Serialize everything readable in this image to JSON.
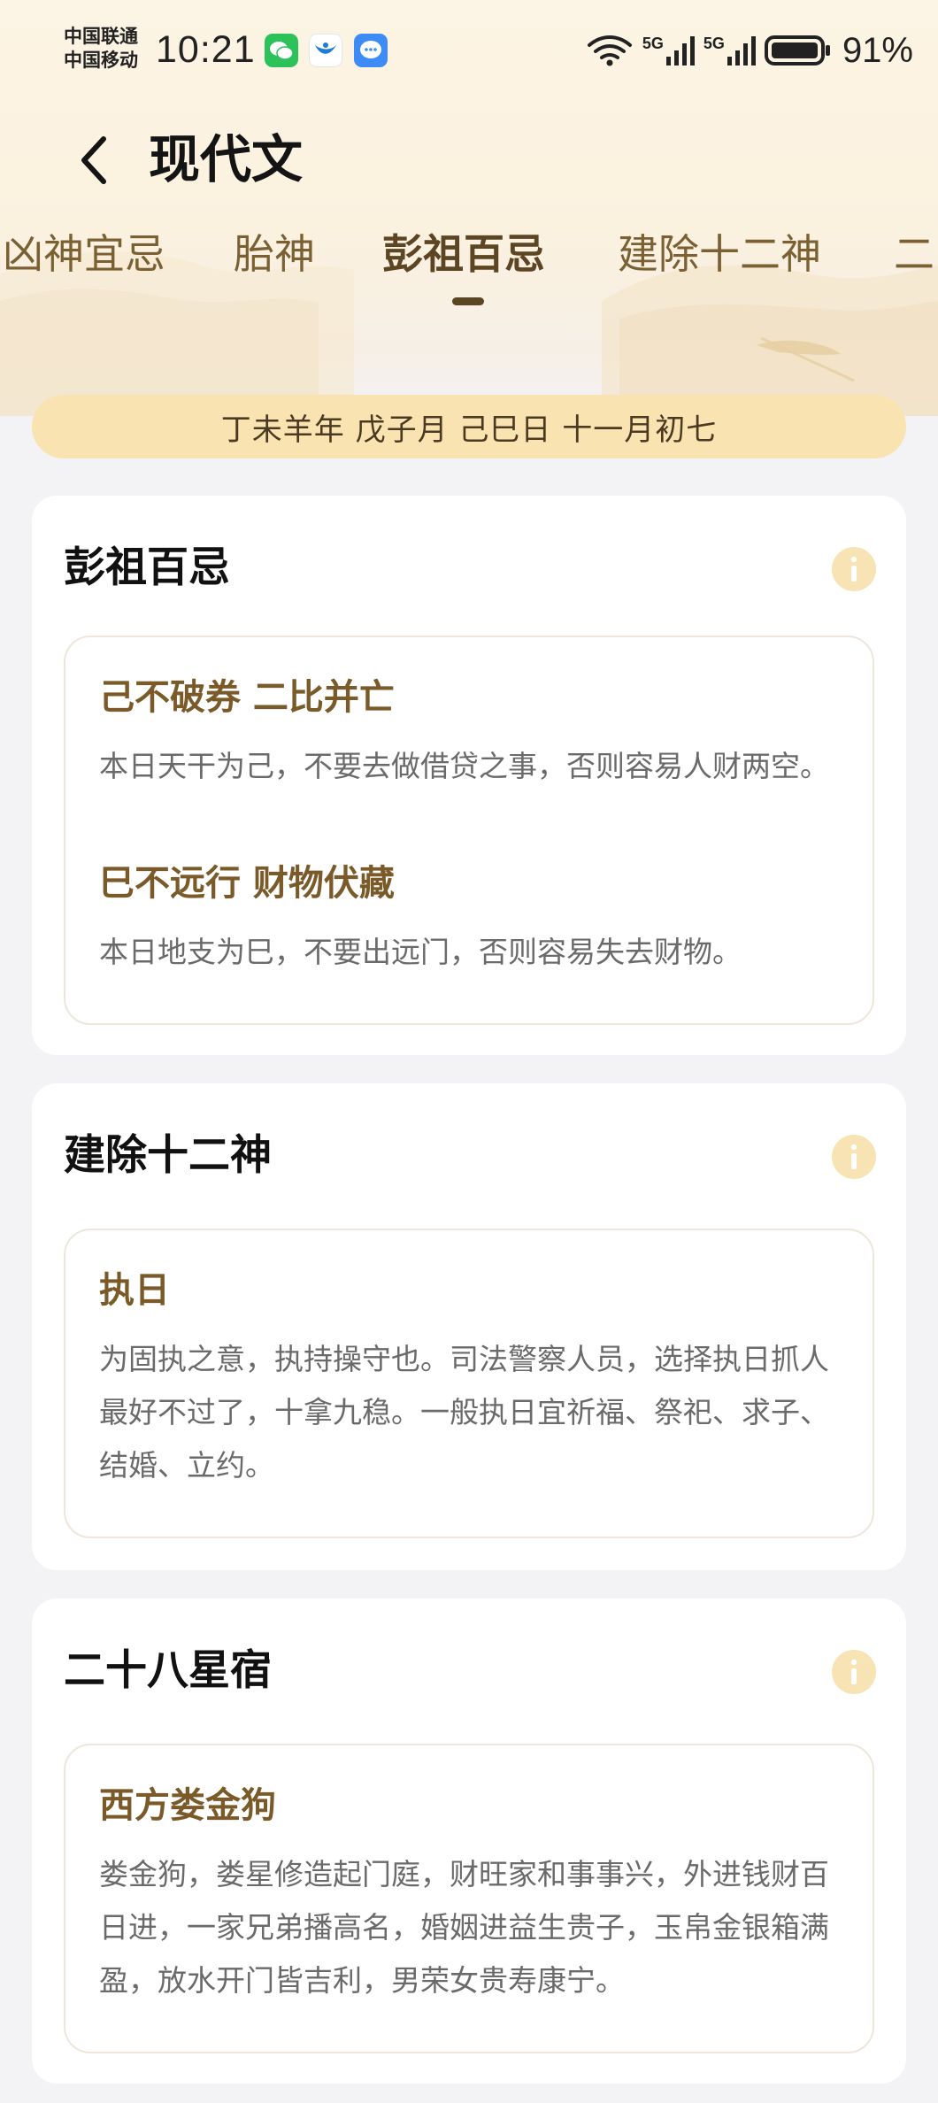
{
  "status_bar": {
    "carrier_1": "中国联通",
    "carrier_2": "中国移动",
    "time": "10:21",
    "network_1": "5G",
    "network_2": "5G",
    "battery": "91%",
    "icons": [
      "wechat-icon",
      "bird-app-icon",
      "message-icon",
      "wifi-icon",
      "signal-icon",
      "battery-icon"
    ]
  },
  "header": {
    "title": "现代文"
  },
  "tabs": [
    {
      "label": "凶神宜忌"
    },
    {
      "label": "胎神"
    },
    {
      "label": "彭祖百忌",
      "active": true
    },
    {
      "label": "建除十二神"
    },
    {
      "label": "二"
    }
  ],
  "date_banner": "丁未羊年  戊子月  己巳日  十一月初七",
  "cards": [
    {
      "title": "彭祖百忌",
      "items": [
        {
          "title": "己不破券 二比并亡",
          "desc": "本日天干为己，不要去做借贷之事，否则容易人财两空。"
        },
        {
          "title": "巳不远行 财物伏藏",
          "desc": "本日地支为巳，不要出远门，否则容易失去财物。"
        }
      ]
    },
    {
      "title": "建除十二神",
      "items": [
        {
          "title": "执日",
          "desc": "为固执之意，执持操守也。司法警察人员，选择执日抓人最好不过了，十拿九稳。一般执日宜祈福、祭祀、求子、结婚、立约。"
        }
      ]
    },
    {
      "title": "二十八星宿",
      "items": [
        {
          "title": "西方娄金狗",
          "desc": "娄金狗，娄星修造起门庭，财旺家和事事兴，外进钱财百日进，一家兄弟播高名，婚姻进益生贵子，玉帛金银箱满盈，放水开门皆吉利，男荣女贵寿康宁。"
        }
      ]
    }
  ],
  "colors": {
    "accent_brown": "#7a5a28",
    "banner_bg": "#f8e3b1",
    "info_icon_bg": "#f7e3b3"
  }
}
